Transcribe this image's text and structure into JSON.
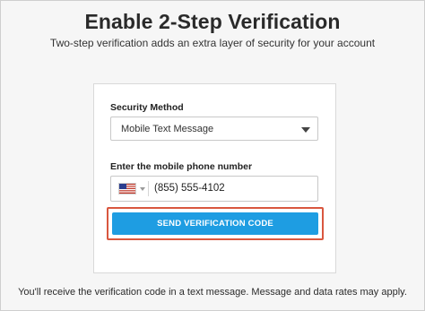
{
  "header": {
    "title": "Enable 2-Step Verification",
    "subtitle": "Two-step verification adds an extra layer of security for your account"
  },
  "form": {
    "method_label": "Security Method",
    "method_value": "Mobile Text Message",
    "phone_label": "Enter the mobile phone number",
    "phone_value": "(855) 555-4102",
    "country_flag": "us-flag-icon",
    "send_button_label": "SEND VERIFICATION CODE"
  },
  "footer": {
    "note": "You'll receive the verification code in a text message. Message and data rates may apply."
  },
  "colors": {
    "button": "#1e9de2",
    "highlight": "#d9573f",
    "background": "#f6f6f6"
  }
}
